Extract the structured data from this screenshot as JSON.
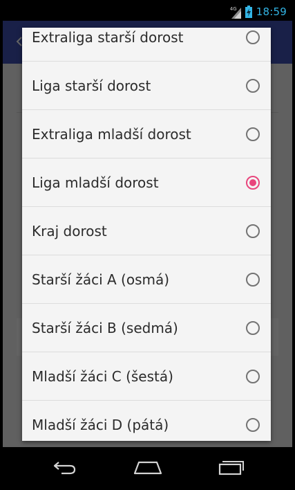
{
  "status_bar": {
    "network": "4G",
    "time": "18:59",
    "icons": [
      "signal-icon",
      "battery-charging-icon"
    ]
  },
  "dialog": {
    "selected_index": 3,
    "options": [
      {
        "label": "Extraliga starší dorost",
        "checked": false
      },
      {
        "label": "Liga starší dorost",
        "checked": false
      },
      {
        "label": "Extraliga mladší dorost",
        "checked": false
      },
      {
        "label": "Liga mladší dorost",
        "checked": true
      },
      {
        "label": "Kraj dorost",
        "checked": false
      },
      {
        "label": "Starší žáci A (osmá)",
        "checked": false
      },
      {
        "label": "Starší žáci B (sedmá)",
        "checked": false
      },
      {
        "label": "Mladší žáci C (šestá)",
        "checked": false
      },
      {
        "label": "Mladší žáci D (pátá)",
        "checked": false
      }
    ]
  },
  "nav_bar": {
    "buttons": [
      "back-icon",
      "home-icon",
      "recent-apps-icon"
    ]
  },
  "colors": {
    "accent": "#e8457c",
    "action_bar": "#3f51b5",
    "clock": "#33b5e5"
  }
}
